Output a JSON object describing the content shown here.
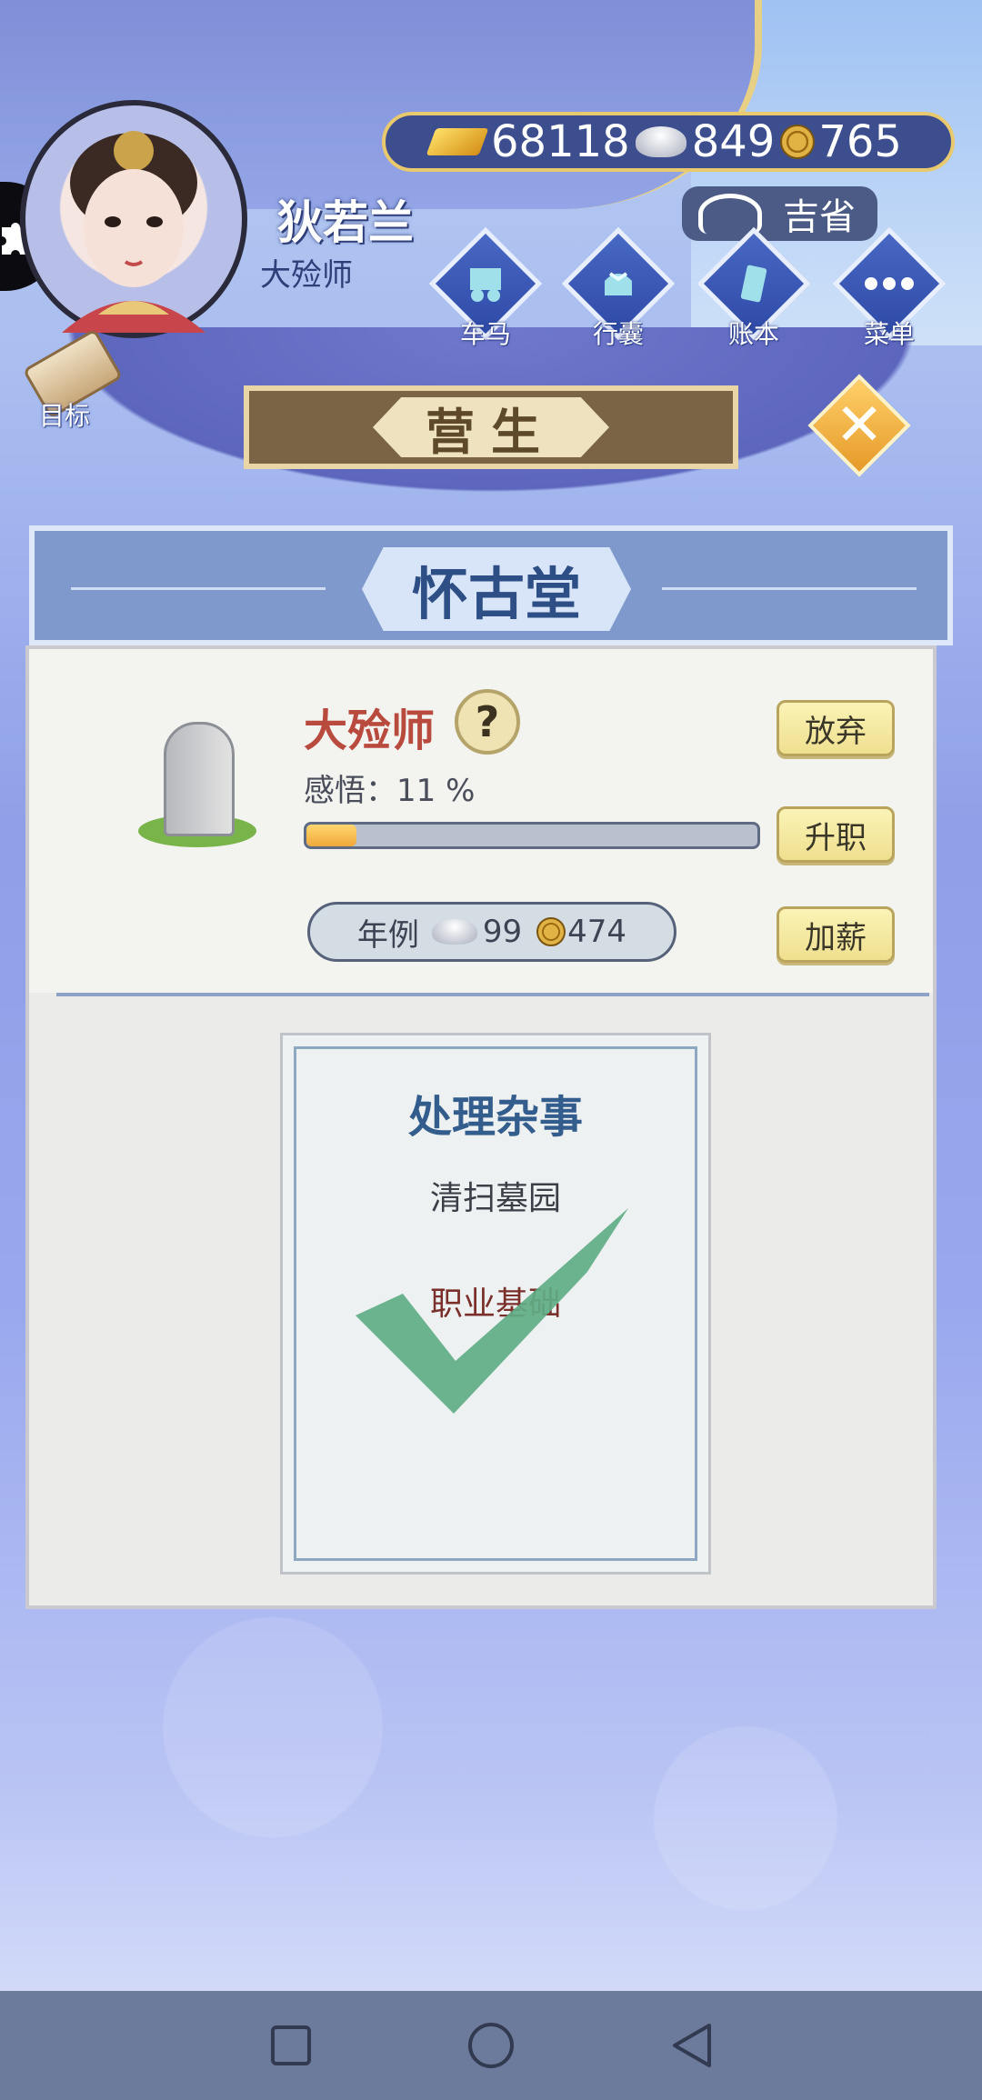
{
  "player": {
    "name": "狄若兰",
    "title": "大殓师"
  },
  "currencies": {
    "gold": "68118",
    "silver": "849",
    "coins": "765"
  },
  "luck": {
    "label": "吉省"
  },
  "menu": [
    {
      "label": "车马",
      "icon": "carriage-icon"
    },
    {
      "label": "行囊",
      "icon": "bundle-icon"
    },
    {
      "label": "账本",
      "icon": "ledger-icon"
    },
    {
      "label": "菜单",
      "icon": "more-icon"
    }
  ],
  "goal": {
    "label": "目标"
  },
  "screen": {
    "title": "营生"
  },
  "shop": {
    "name": "怀古堂"
  },
  "job": {
    "name": "大殓师",
    "help": "?",
    "insight_label": "感悟：11 %",
    "progress": 0.11,
    "salary_label": "年例",
    "salary_silver": "99",
    "salary_coins": "474",
    "buttons": {
      "abandon": "放弃",
      "promote": "升职",
      "raise": "加薪"
    }
  },
  "task": {
    "title": "处理杂事",
    "description": "清扫墓园",
    "requirement": "职业基础",
    "completed": true
  },
  "colors": {
    "accent": "#2d4f86",
    "job_name": "#b94a3e",
    "check": "#5fae86"
  }
}
